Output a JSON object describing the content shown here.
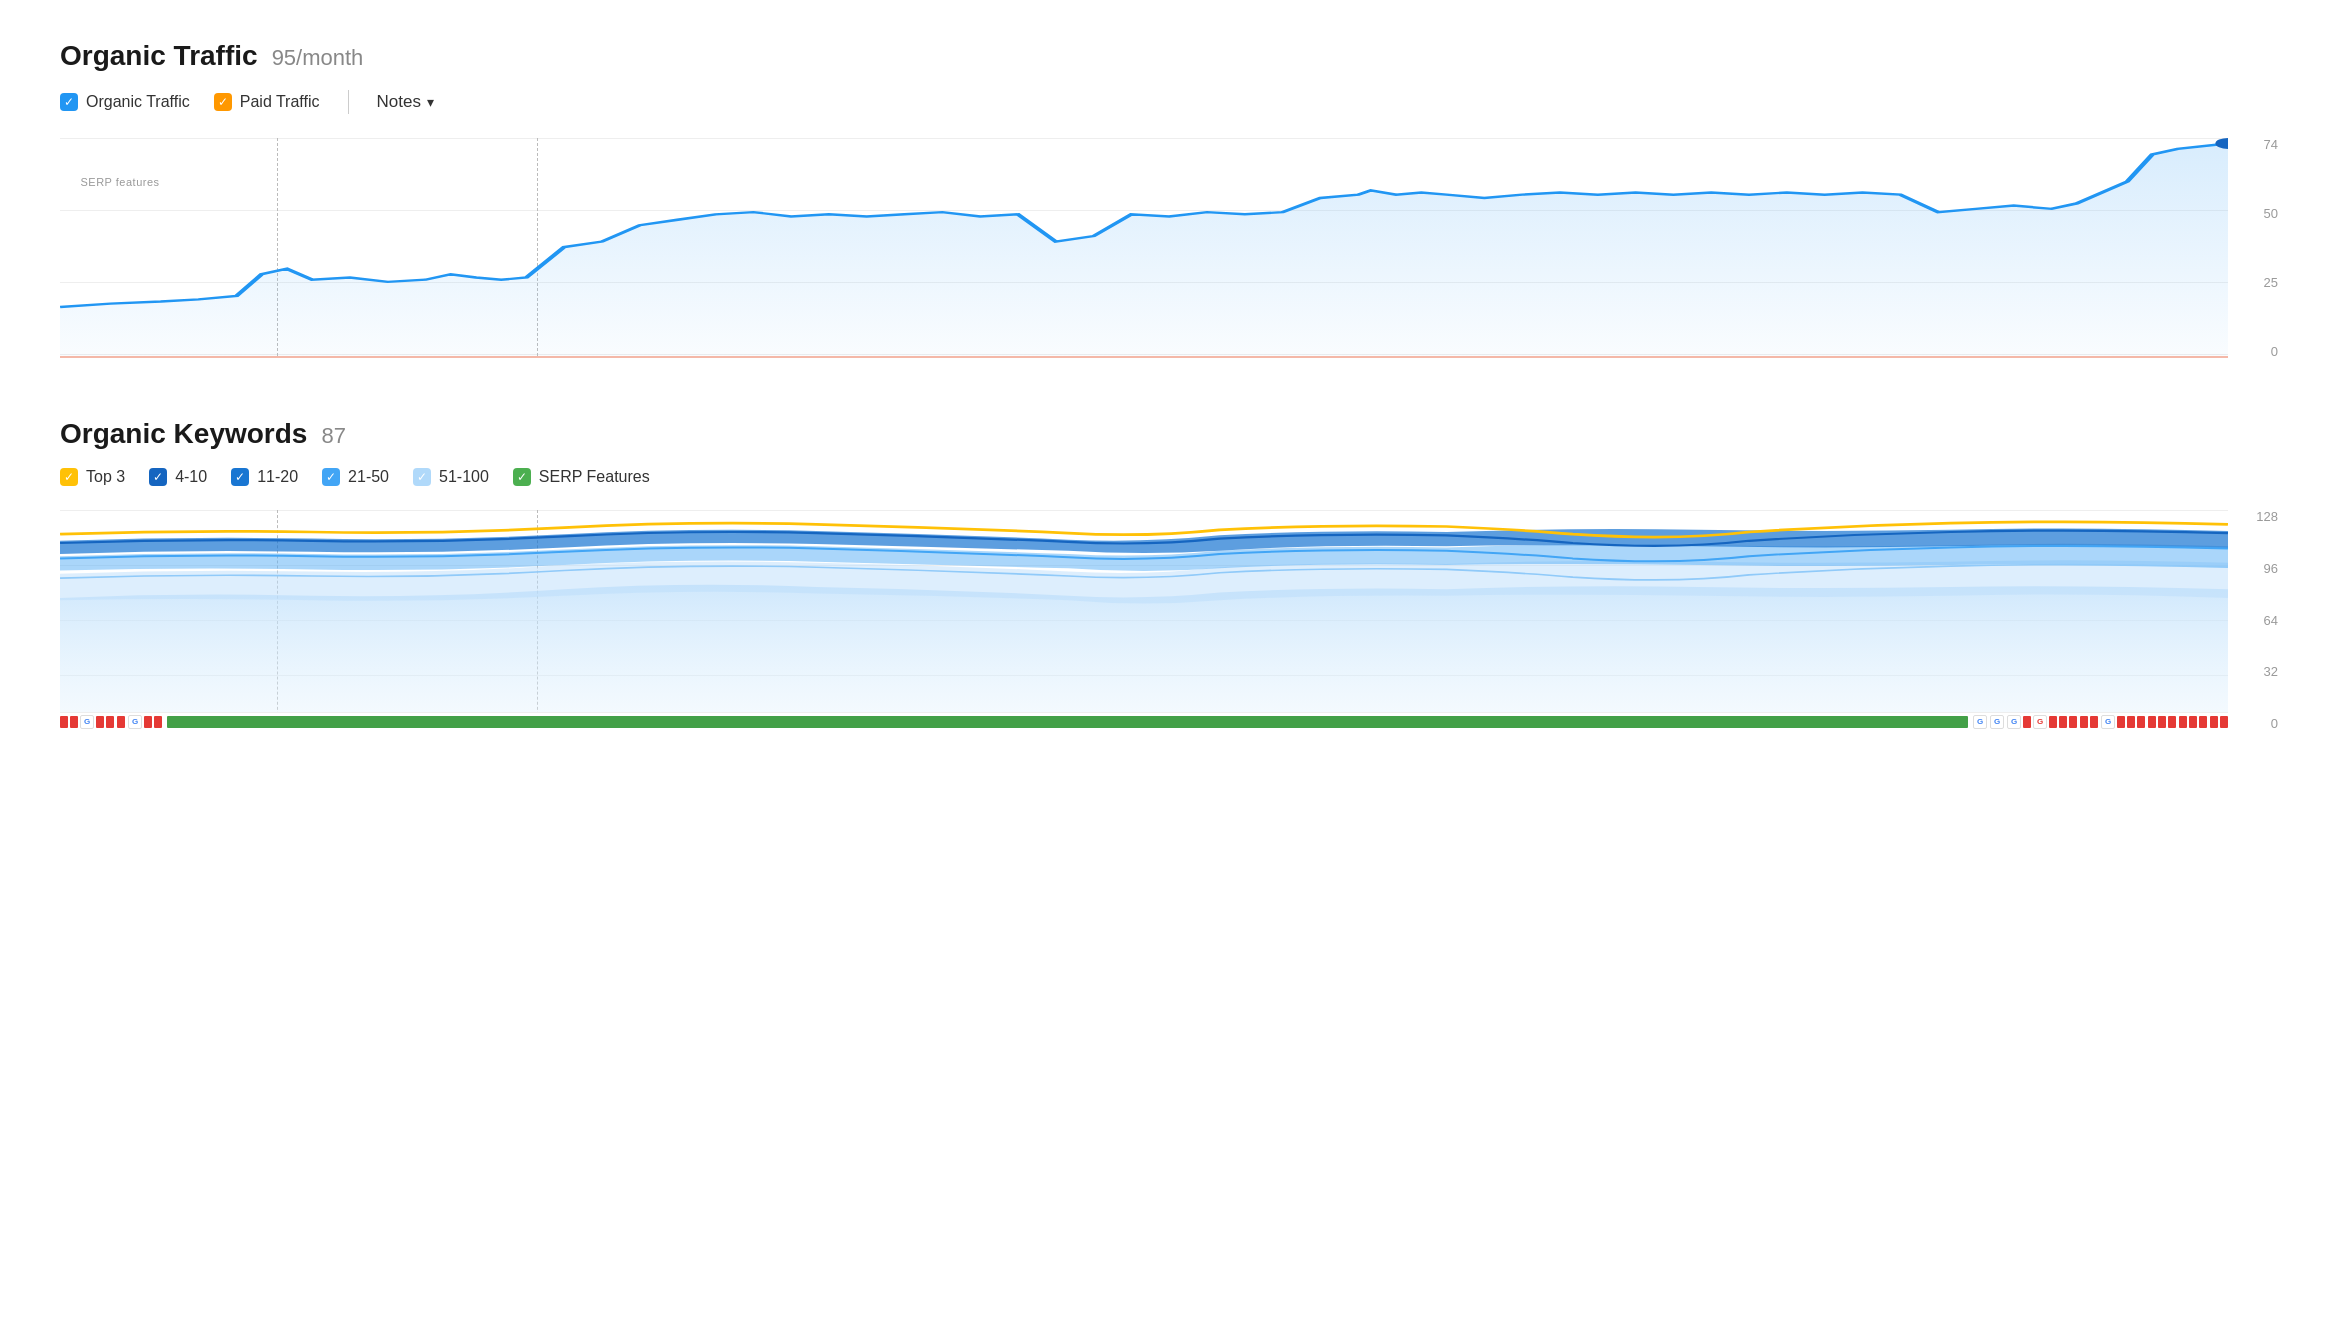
{
  "organic_traffic": {
    "title": "Organic Traffic",
    "subtitle": "95/month",
    "legend": [
      {
        "id": "organic",
        "label": "Organic Traffic",
        "color": "#2196F3",
        "checked": true
      },
      {
        "id": "paid",
        "label": "Paid Traffic",
        "color": "#FF9800",
        "checked": true
      }
    ],
    "notes_label": "Notes",
    "y_axis": [
      "74",
      "50",
      "25",
      "0"
    ],
    "serp_label": "SERP features"
  },
  "organic_keywords": {
    "title": "Organic Keywords",
    "subtitle": "87",
    "legend": [
      {
        "id": "top3",
        "label": "Top 3",
        "color": "#FFC107",
        "checked": true
      },
      {
        "id": "4-10",
        "label": "4-10",
        "color": "#1565C0",
        "checked": true
      },
      {
        "id": "11-20",
        "label": "11-20",
        "color": "#1976D2",
        "checked": true
      },
      {
        "id": "21-50",
        "label": "21-50",
        "color": "#42A5F5",
        "checked": true
      },
      {
        "id": "51-100",
        "label": "51-100",
        "color": "#90CAF9",
        "checked": true
      },
      {
        "id": "serp",
        "label": "SERP Features",
        "color": "#4CAF50",
        "checked": true
      }
    ],
    "y_axis": [
      "128",
      "96",
      "64",
      "32",
      "0"
    ]
  }
}
